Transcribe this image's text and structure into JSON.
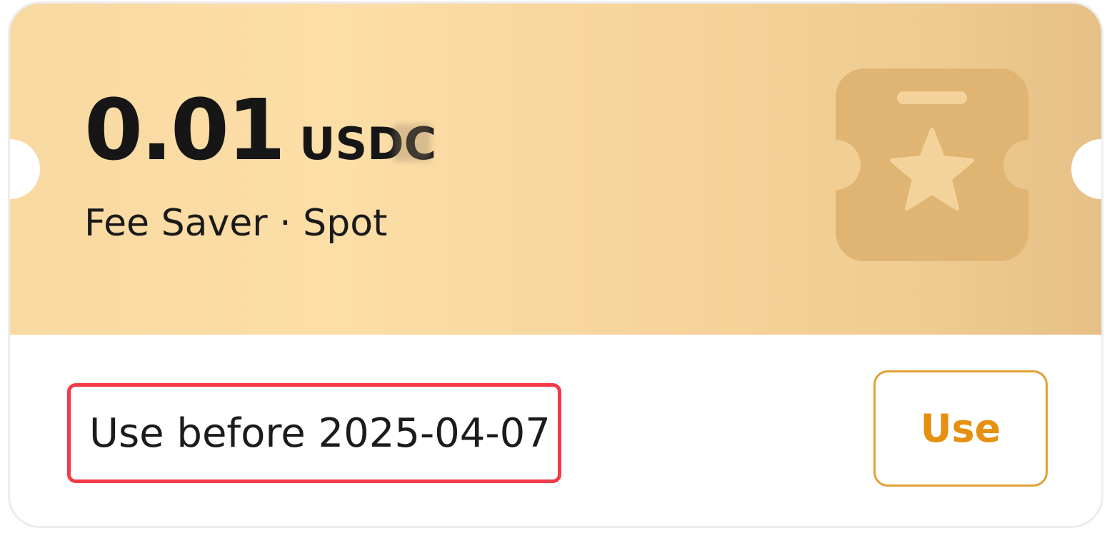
{
  "coupon": {
    "amount": "0.01",
    "currency": "USDC",
    "type_label": "Fee Saver · Spot",
    "expiry_text": "Use before 2025-04-07",
    "use_button_label": "Use",
    "icon": "ticket-star-icon"
  },
  "colors": {
    "gradient_start": "#f8d9a1",
    "gradient_end": "#e6c086",
    "icon_fill": "#e0b472",
    "accent_orange": "#e5900f",
    "highlight_red": "#f23a48"
  }
}
